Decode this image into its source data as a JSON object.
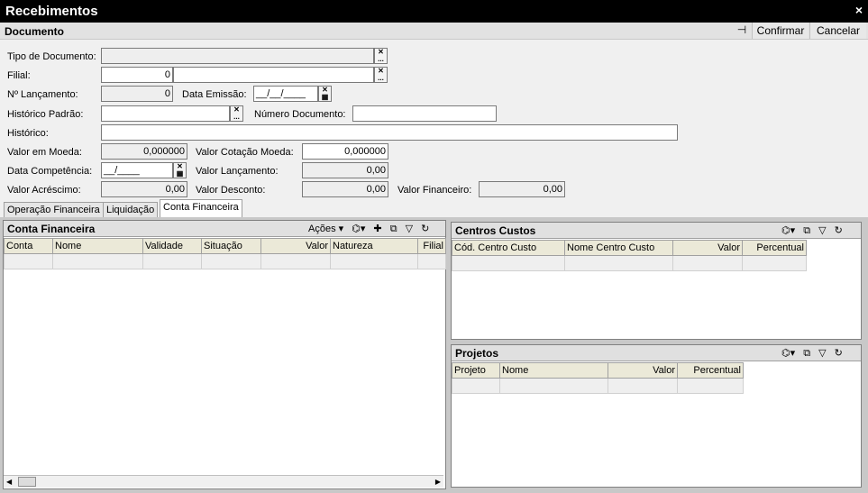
{
  "window": {
    "title": "Recebimentos",
    "close": "×"
  },
  "toolbar": {
    "section": "Documento",
    "pin": "⊣",
    "confirm": "Confirmar",
    "cancel": "Cancelar"
  },
  "form": {
    "tipo_documento": {
      "label": "Tipo de Documento:",
      "value": ""
    },
    "filial": {
      "label": "Filial:",
      "code": "0",
      "name": ""
    },
    "num_lancamento": {
      "label": "Nº Lançamento:",
      "value": "0"
    },
    "data_emissao": {
      "label": "Data Emissão:",
      "value": "__/__/____"
    },
    "historico_padrao": {
      "label": "Histórico Padrão:",
      "value": ""
    },
    "numero_documento": {
      "label": "Número Documento:",
      "value": ""
    },
    "historico": {
      "label": "Histórico:",
      "value": ""
    },
    "valor_moeda": {
      "label": "Valor em Moeda:",
      "value": "0,000000"
    },
    "valor_cotacao_moeda": {
      "label": "Valor Cotação Moeda:",
      "value": "0,000000"
    },
    "data_competencia": {
      "label": "Data Competência:",
      "value": "__/____"
    },
    "valor_lancamento": {
      "label": "Valor Lançamento:",
      "value": "0,00"
    },
    "valor_acrescimo": {
      "label": "Valor Acréscimo:",
      "value": "0,00"
    },
    "valor_desconto": {
      "label": "Valor Desconto:",
      "value": "0,00"
    },
    "valor_financeiro": {
      "label": "Valor Financeiro:",
      "value": "0,00"
    }
  },
  "icons": {
    "clear": "✕",
    "lookup": "...",
    "calendar": "▦"
  },
  "tabs": [
    "Operação Financeira",
    "Liquidação",
    "Conta Financeira"
  ],
  "active_tab": "Conta Financeira",
  "conta_financeira": {
    "title": "Conta Financeira",
    "actions": "Ações ▾",
    "columns": [
      "Conta",
      "Nome",
      "Validade",
      "Situação",
      "Valor",
      "Natureza",
      "Filial"
    ]
  },
  "centros_custos": {
    "title": "Centros Custos",
    "columns": [
      "Cód. Centro Custo",
      "Nome Centro Custo",
      "Valor",
      "Percentual"
    ]
  },
  "projetos": {
    "title": "Projetos",
    "columns": [
      "Projeto",
      "Nome",
      "Valor",
      "Percentual"
    ]
  },
  "tool_icons": {
    "view": "⌬▾",
    "add": "✚",
    "export": "⧉",
    "filter": "▽",
    "refresh": "↻"
  }
}
